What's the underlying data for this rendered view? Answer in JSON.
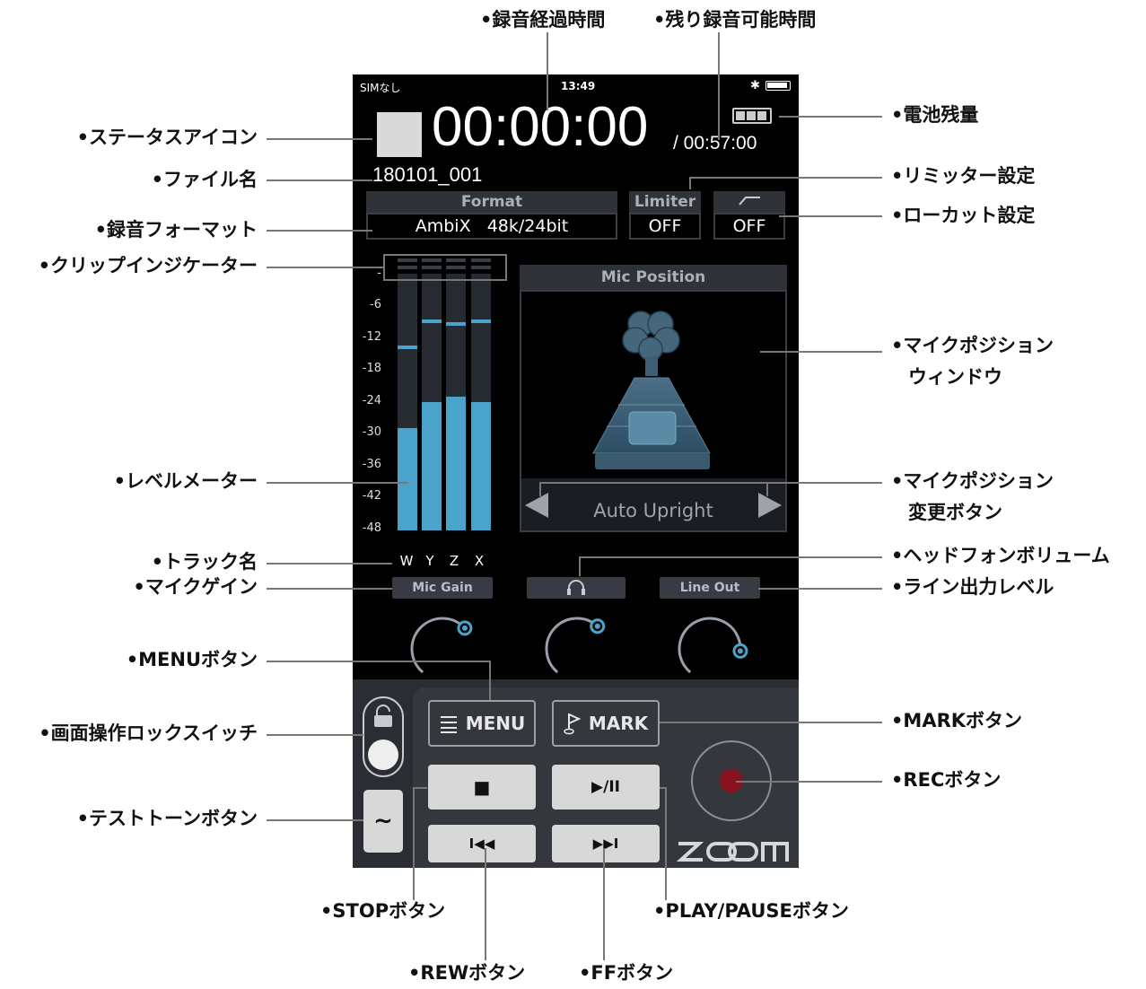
{
  "status_bar": {
    "carrier": "SIMなし",
    "time": "13:49",
    "bluetooth_icon": "bluetooth-icon",
    "battery_icon": "phone-battery-icon"
  },
  "recorder": {
    "elapsed_time": "00:00:00",
    "remaining_time": "/ 00:57:00",
    "file_name": "180101_001",
    "format": {
      "header": "Format",
      "value": "AmbiX   48k/24bit"
    },
    "limiter": {
      "header": "Limiter",
      "value": "OFF"
    },
    "lowcut": {
      "header_icon": "lowcut-icon",
      "value": "OFF"
    },
    "meter": {
      "scale": [
        "-",
        "-6",
        "-12",
        "-18",
        "-24",
        "-30",
        "-36",
        "-42",
        "-48"
      ],
      "tracks": [
        {
          "name": "W",
          "level_db": -30,
          "peak_db": -14
        },
        {
          "name": "Y",
          "level_db": -25,
          "peak_db": -9
        },
        {
          "name": "Z",
          "level_db": -24,
          "peak_db": -9.5
        },
        {
          "name": "X",
          "level_db": -25,
          "peak_db": -9
        }
      ]
    },
    "mic_position": {
      "header": "Mic Position",
      "value": "Auto Upright"
    },
    "knobs": [
      {
        "label": "Mic Gain",
        "icon": "",
        "level": 0.72
      },
      {
        "label": "",
        "icon": "headphone-icon",
        "level": 0.7
      },
      {
        "label": "Line Out",
        "icon": "",
        "level": 0.9
      }
    ],
    "buttons": {
      "menu": "MENU",
      "mark": "MARK",
      "stop": "■",
      "play_pause": "▶/II",
      "rew": "I◀◀",
      "ff": "▶▶I"
    },
    "logo": "ZOOM",
    "colors": {
      "accent": "#4ba3cc",
      "rec": "#8a1020",
      "background": "#000000"
    }
  },
  "callouts": {
    "elapsed": "•録音経過時間",
    "remaining": "•残り録音可能時間",
    "status_icon": "•ステータスアイコン",
    "battery": "•電池残量",
    "file_name": "•ファイル名",
    "limiter": "•リミッター設定",
    "format": "•録音フォーマット",
    "lowcut": "•ローカット設定",
    "clip": "•クリップインジケーター",
    "mic_window_1": "•マイクポジション",
    "mic_window_2": "ウィンドウ",
    "level_meter": "•レベルメーター",
    "mic_change_1": "•マイクポジション",
    "mic_change_2": "変更ボタン",
    "track_name": "•トラック名",
    "headphone": "•ヘッドフォンボリューム",
    "mic_gain": "•マイクゲイン",
    "line_out": "•ライン出力レベル",
    "menu": "•MENUボタン",
    "lock": "•画面操作ロックスイッチ",
    "mark": "•MARKボタン",
    "rec": "•RECボタン",
    "test_tone": "•テストトーンボタン",
    "stop": "•STOPボタン",
    "play_pause": "•PLAY/PAUSEボタン",
    "rew": "•REWボタン",
    "ff": "•FFボタン"
  }
}
